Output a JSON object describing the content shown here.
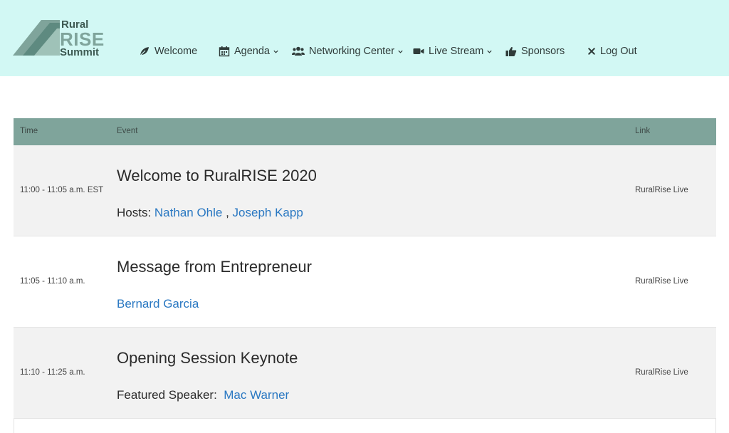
{
  "brand": {
    "line1": "Rural",
    "line2": "RISE",
    "line3": "Summit"
  },
  "nav": {
    "items": [
      {
        "label": "Welcome",
        "icon": "leaf-icon",
        "dropdown": false
      },
      {
        "label": "Agenda",
        "icon": "calendar-icon",
        "dropdown": true
      },
      {
        "label": "Networking Center",
        "icon": "users-icon",
        "dropdown": true
      },
      {
        "label": "Live Stream",
        "icon": "video-camera-icon",
        "dropdown": true
      },
      {
        "label": "Sponsors",
        "icon": "thumbs-up-icon",
        "dropdown": false
      },
      {
        "label": "Log Out",
        "icon": "close-icon",
        "dropdown": false
      }
    ]
  },
  "table": {
    "headers": {
      "time": "Time",
      "event": "Event",
      "link": "Link"
    },
    "rows": [
      {
        "time": "11:00 - 11:05 a.m. EST",
        "title": "Welcome to RuralRISE 2020",
        "sub_prefix": "Hosts: ",
        "people": [
          "Nathan Ohle",
          "Joseph Kapp"
        ],
        "separator": " , ",
        "link": "RuralRise Live"
      },
      {
        "time": "11:05 - 11:10 a.m.",
        "title": "Message from Entrepreneur",
        "sub_prefix": "",
        "people": [
          "Bernard Garcia"
        ],
        "link": "RuralRise Live"
      },
      {
        "time": "11:10 - 11:25 a.m.",
        "title": "Opening Session Keynote",
        "sub_prefix": "Featured Speaker:  ",
        "people": [
          "Mac Warner"
        ],
        "link": "RuralRise Live"
      }
    ]
  },
  "colors": {
    "header_bg": "#d2f8f4",
    "table_header_bg": "#7fa49b",
    "row_alt_bg": "#f2f2f2",
    "link": "#2a78c2"
  }
}
